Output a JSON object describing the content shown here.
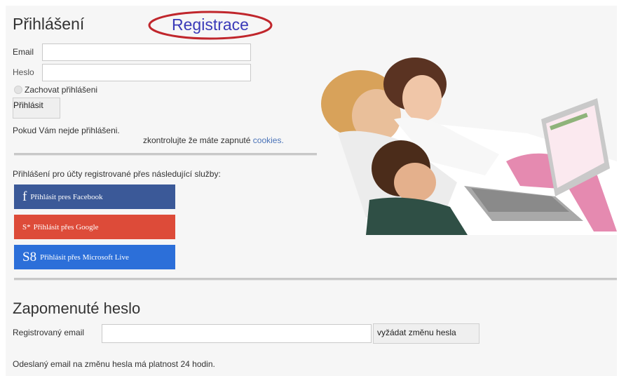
{
  "login": {
    "title": "Přihlášení",
    "register_link": "Registrace",
    "email_label": "Email",
    "email_value": "",
    "password_label": "Heslo",
    "password_value": "",
    "remember_label": "Zachovat přihlášeni",
    "submit_label": "Přihlásit",
    "trouble_text": "Pokud Vám nejde přihlášeni.",
    "check_text": "zkontrolujte že máte zapnuté",
    "cookies_link": "cookies.",
    "services_text": "Přihlášení pro účty registrované přes následující služby:"
  },
  "social": {
    "facebook": {
      "glyph": "f",
      "label": "Přihlásit pres Facebook",
      "color": "#3b5998"
    },
    "google": {
      "glyph": "S*",
      "label": "Přihlásit přes Google",
      "color": "#dd4b39"
    },
    "microsoft": {
      "glyph": "S8",
      "label": "Přihlásit přes Microsoft Live",
      "color": "#2c6fd9"
    }
  },
  "forgot": {
    "title": "Zapomenuté heslo",
    "email_label": "Registrovaný email",
    "email_value": "",
    "submit_label": "vyžádat změnu hesla",
    "note": "Odeslaný email na změnu hesla má platnost 24 hodin."
  },
  "hero": {
    "icon": "family-laptop-photo"
  }
}
